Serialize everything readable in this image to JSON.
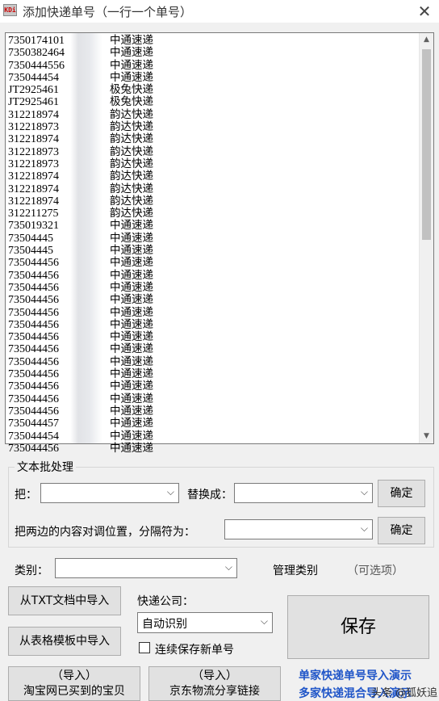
{
  "window": {
    "icon_text": "KDi",
    "title": "添加快递单号（一行一个单号）",
    "close_glyph": "✕"
  },
  "textarea": {
    "lines": [
      {
        "num": "7350174101",
        "carrier": "中通速递"
      },
      {
        "num": "7350382464",
        "carrier": "中通速递"
      },
      {
        "num": "7350444556",
        "carrier": "中通速递"
      },
      {
        "num": "735044454",
        "carrier": "中通速递"
      },
      {
        "num": "JT2925461",
        "carrier": "极兔快递"
      },
      {
        "num": "JT2925461",
        "carrier": "极兔快递"
      },
      {
        "num": "312218974",
        "carrier": "韵达快递"
      },
      {
        "num": "312218973",
        "carrier": "韵达快递"
      },
      {
        "num": "312218974",
        "carrier": "韵达快递"
      },
      {
        "num": "312218973",
        "carrier": "韵达快递"
      },
      {
        "num": "312218973",
        "carrier": "韵达快递"
      },
      {
        "num": "312218974",
        "carrier": "韵达快递"
      },
      {
        "num": "312218974",
        "carrier": "韵达快递"
      },
      {
        "num": "312218974",
        "carrier": "韵达快递"
      },
      {
        "num": "312211275",
        "carrier": "韵达快递"
      },
      {
        "num": "735019321",
        "carrier": "中通速递"
      },
      {
        "num": "73504445",
        "carrier": "中通速递"
      },
      {
        "num": "73504445",
        "carrier": "中通速递"
      },
      {
        "num": "735044456",
        "carrier": "中通速递"
      },
      {
        "num": "735044456",
        "carrier": "中通速递"
      },
      {
        "num": "735044456",
        "carrier": "中通速递"
      },
      {
        "num": "735044456",
        "carrier": "中通速递"
      },
      {
        "num": "735044456",
        "carrier": "中通速递"
      },
      {
        "num": "735044456",
        "carrier": "中通速递"
      },
      {
        "num": "735044456",
        "carrier": "中通速递"
      },
      {
        "num": "735044456",
        "carrier": "中通速递"
      },
      {
        "num": "735044456",
        "carrier": "中通速递"
      },
      {
        "num": "735044456",
        "carrier": "中通速递"
      },
      {
        "num": "735044456",
        "carrier": "中通速递"
      },
      {
        "num": "735044456",
        "carrier": "中通速递"
      },
      {
        "num": "735044456",
        "carrier": "中通速递"
      },
      {
        "num": "735044457",
        "carrier": "中通速递"
      },
      {
        "num": "735044454",
        "carrier": "中通速递"
      },
      {
        "num": "735044456",
        "carrier": "中通速递"
      }
    ],
    "scroll_up_glyph": "▲",
    "scroll_down_glyph": "▼"
  },
  "batch": {
    "group_title": "文本批处理",
    "replace_label": "把：",
    "replace_with_label": "替换成：",
    "confirm_label": "确定",
    "swap_label": "把两边的内容对调位置，分隔符为：",
    "confirm2_label": "确定",
    "arrow_glyph": "⌵"
  },
  "category": {
    "label": "类别：",
    "manage_label": "管理类别",
    "optional_label": "（可选项）"
  },
  "import": {
    "txt_label": "从TXT文档中导入",
    "table_label": "从表格模板中导入",
    "taobao_line1": "（导入）",
    "taobao_line2": "淘宝网已买到的宝贝",
    "jd_line1": "（导入）",
    "jd_line2": "京东物流分享链接"
  },
  "company": {
    "label": "快递公司：",
    "selected": "自动识别"
  },
  "save": {
    "label": "保存",
    "continuous_label": "连续保存新单号"
  },
  "links": {
    "single_demo": "单家快递单号导入演示",
    "multi_demo": "多家快递混合导入演示"
  },
  "watermark": "头条 @狐妖追"
}
